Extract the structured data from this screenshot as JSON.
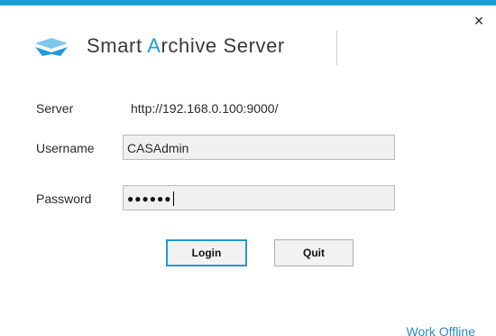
{
  "app": {
    "title_part1": "Smart ",
    "title_accent": "A",
    "title_part2": "rchive Server",
    "accent_color": "#1f9ad9"
  },
  "icons": {
    "close": "close-icon",
    "logo": "logo-icon"
  },
  "close_glyph": "×",
  "form": {
    "server": {
      "label": "Server",
      "value": "http://192.168.0.100:9000/"
    },
    "username": {
      "label": "Username",
      "value": "CASAdmin"
    },
    "password": {
      "label": "Password",
      "masked_value": "●●●●●●"
    }
  },
  "buttons": {
    "login": "Login",
    "quit": "Quit"
  },
  "links": {
    "work_offline": "Work Offline"
  }
}
